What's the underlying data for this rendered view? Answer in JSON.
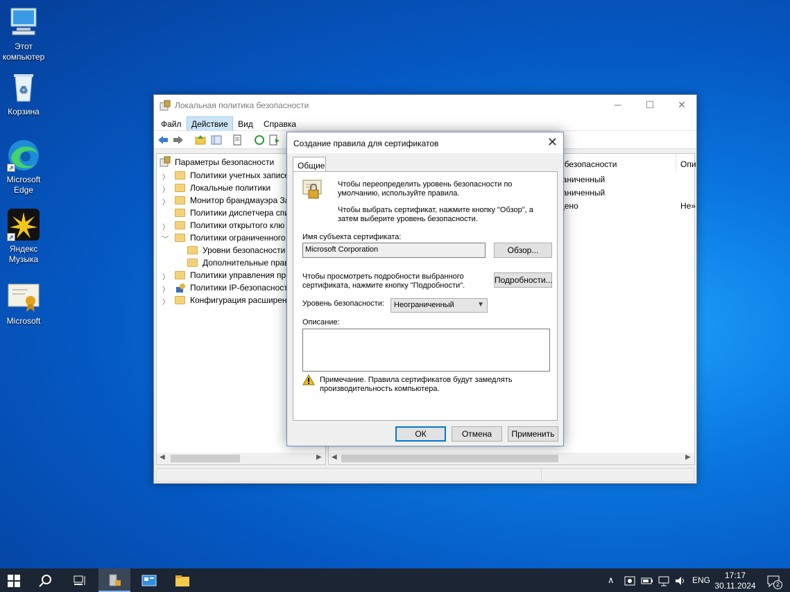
{
  "desktop": {
    "icons": [
      {
        "label": "Этот компьютер",
        "icon": "computer-icon"
      },
      {
        "label": "Корзина",
        "icon": "recycle-bin-icon"
      },
      {
        "label": "Microsoft Edge",
        "icon": "edge-icon"
      },
      {
        "label": "Яндекс Музыка",
        "icon": "yandex-music-icon"
      },
      {
        "label": "Microsoft",
        "icon": "certificate-icon"
      }
    ]
  },
  "window": {
    "title": "Локальная политика безопасности",
    "menu": [
      "Файл",
      "Действие",
      "Вид",
      "Справка"
    ],
    "tree": {
      "root": "Параметры безопасности",
      "items": [
        "Политики учетных записе",
        "Локальные политики",
        "Монитор брандмауэра За",
        "Политики диспетчера спи",
        "Политики открытого клю",
        "Политики ограниченного",
        "Уровни безопасности",
        "Дополнительные прав",
        "Политики управления при",
        "Политики IP-безопасност",
        "Конфигурация расширен"
      ]
    },
    "right_pane": {
      "col1_header": "ь безопасности",
      "col2_header": "Опи",
      "rows": [
        {
          "c1": "раниченный",
          "c2": ""
        },
        {
          "c1": "раниченный",
          "c2": ""
        },
        {
          "c1": "щено",
          "c2": "Не»"
        }
      ]
    }
  },
  "dialog": {
    "title": "Создание правила для сертификатов",
    "tab": "Общие",
    "intro1": "Чтобы переопределить уровень безопасности по умолчанию, используйте правила.",
    "intro2": "Чтобы выбрать сертификат, нажмите кнопку \"Обзор\", а затем выберите уровень безопасности.",
    "subject_label": "Имя субъекта сертификата:",
    "subject_value": "Microsoft Corporation",
    "browse_button": "Обзор...",
    "details_text": "Чтобы просмотреть подробности выбранного сертификата, нажмите кнопку \"Подробности\".",
    "details_button": "Подробности...",
    "level_label": "Уровень безопасности:",
    "level_value": "Неограниченный",
    "description_label": "Описание:",
    "note": "Примечание.  Правила сертификатов будут замедлять производительность компьютера.",
    "ok": "ОК",
    "cancel": "Отмена",
    "apply": "Применить"
  },
  "taskbar": {
    "lang": "ENG",
    "time": "17:17",
    "date": "30.11.2024",
    "notifications": "2"
  }
}
